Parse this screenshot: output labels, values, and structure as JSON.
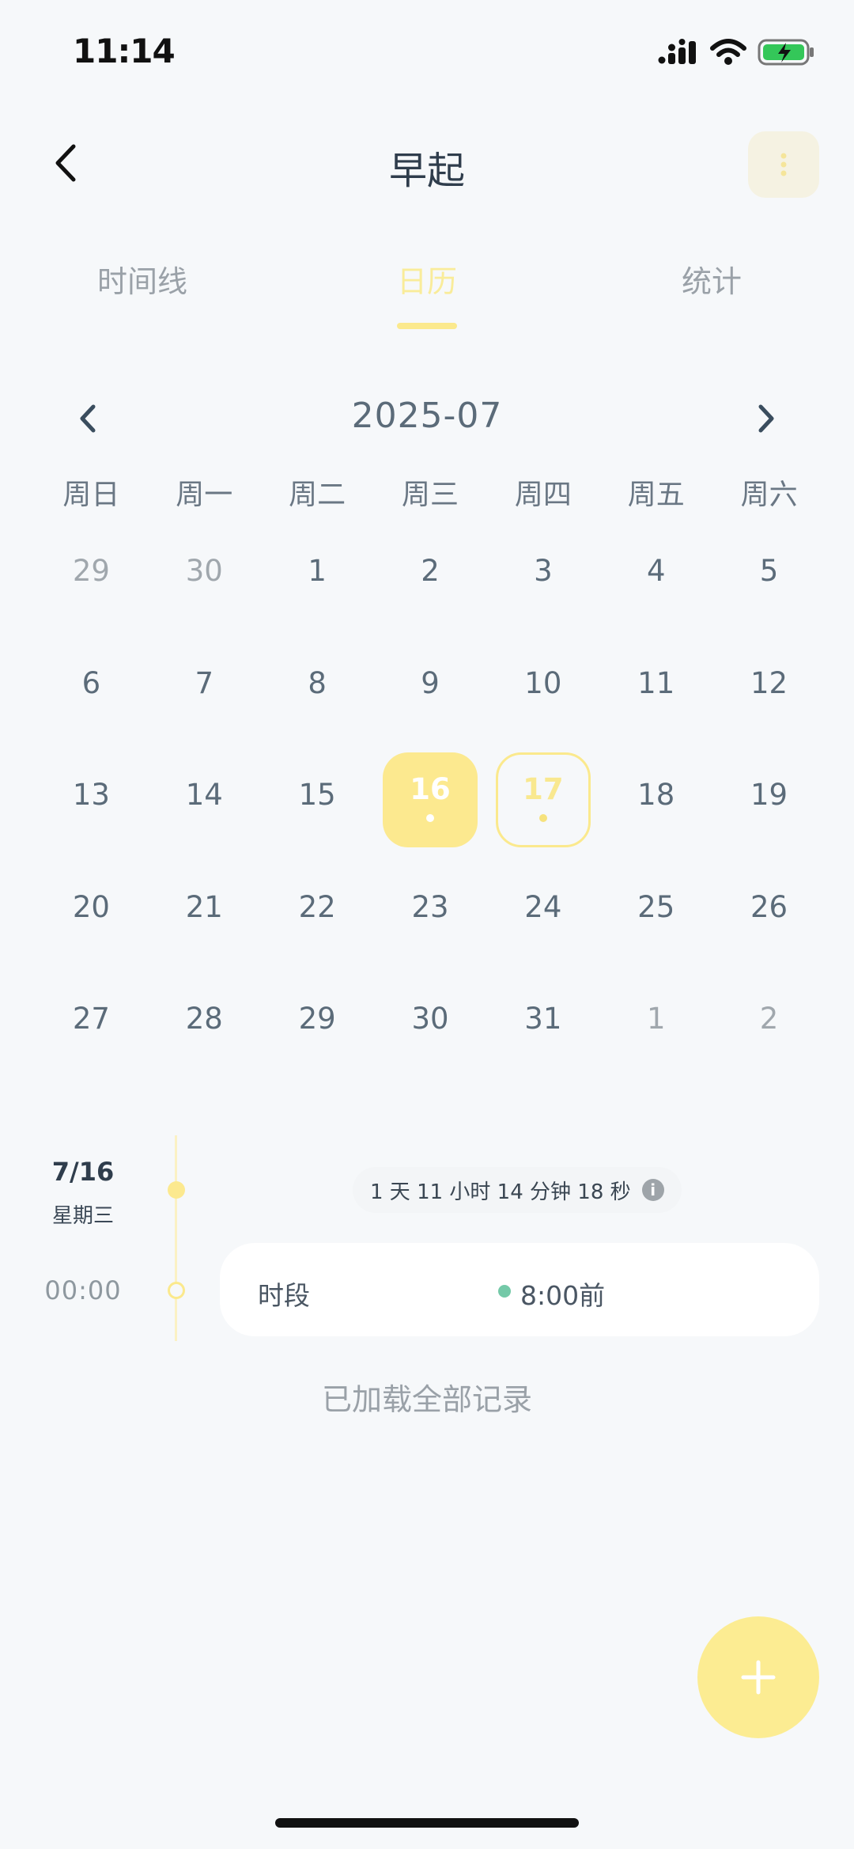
{
  "status_bar": {
    "time": "11:14"
  },
  "header": {
    "title": "早起"
  },
  "tabs": [
    {
      "label": "时间线",
      "active": false
    },
    {
      "label": "日历",
      "active": true
    },
    {
      "label": "统计",
      "active": false
    }
  ],
  "calendar": {
    "month": "2025-07",
    "weekdays": [
      "周日",
      "周一",
      "周二",
      "周三",
      "周四",
      "周五",
      "周六"
    ],
    "days": [
      {
        "d": "29",
        "muted": true
      },
      {
        "d": "30",
        "muted": true
      },
      {
        "d": "1"
      },
      {
        "d": "2"
      },
      {
        "d": "3"
      },
      {
        "d": "4"
      },
      {
        "d": "5"
      },
      {
        "d": "6"
      },
      {
        "d": "7"
      },
      {
        "d": "8"
      },
      {
        "d": "9"
      },
      {
        "d": "10"
      },
      {
        "d": "11"
      },
      {
        "d": "12"
      },
      {
        "d": "13"
      },
      {
        "d": "14"
      },
      {
        "d": "15"
      },
      {
        "d": "16",
        "state": "selected",
        "has_record": true
      },
      {
        "d": "17",
        "state": "today",
        "has_record": true
      },
      {
        "d": "18"
      },
      {
        "d": "19"
      },
      {
        "d": "20"
      },
      {
        "d": "21"
      },
      {
        "d": "22"
      },
      {
        "d": "23"
      },
      {
        "d": "24"
      },
      {
        "d": "25"
      },
      {
        "d": "26"
      },
      {
        "d": "27"
      },
      {
        "d": "28"
      },
      {
        "d": "29"
      },
      {
        "d": "30"
      },
      {
        "d": "31"
      },
      {
        "d": "1",
        "muted": true
      },
      {
        "d": "2",
        "muted": true
      }
    ]
  },
  "timeline": {
    "date": "7/16",
    "weekday": "星期三",
    "duration": "1 天 11 小时 14 分钟 18 秒",
    "entries": [
      {
        "time": "00:00",
        "label": "时段",
        "value": "8:00前",
        "dot_color": "#74c9a8"
      }
    ],
    "footer": "已加载全部记录"
  },
  "colors": {
    "accent": "#fce98f",
    "accent_text": "#f9ec9a",
    "background": "#f6f8fa",
    "text": "#5b6b79"
  },
  "icons": [
    "back-chevron-icon",
    "more-vertical-icon",
    "prev-month-icon",
    "next-month-icon",
    "info-icon",
    "plus-icon",
    "signal-icon",
    "wifi-icon",
    "battery-charging-icon"
  ]
}
